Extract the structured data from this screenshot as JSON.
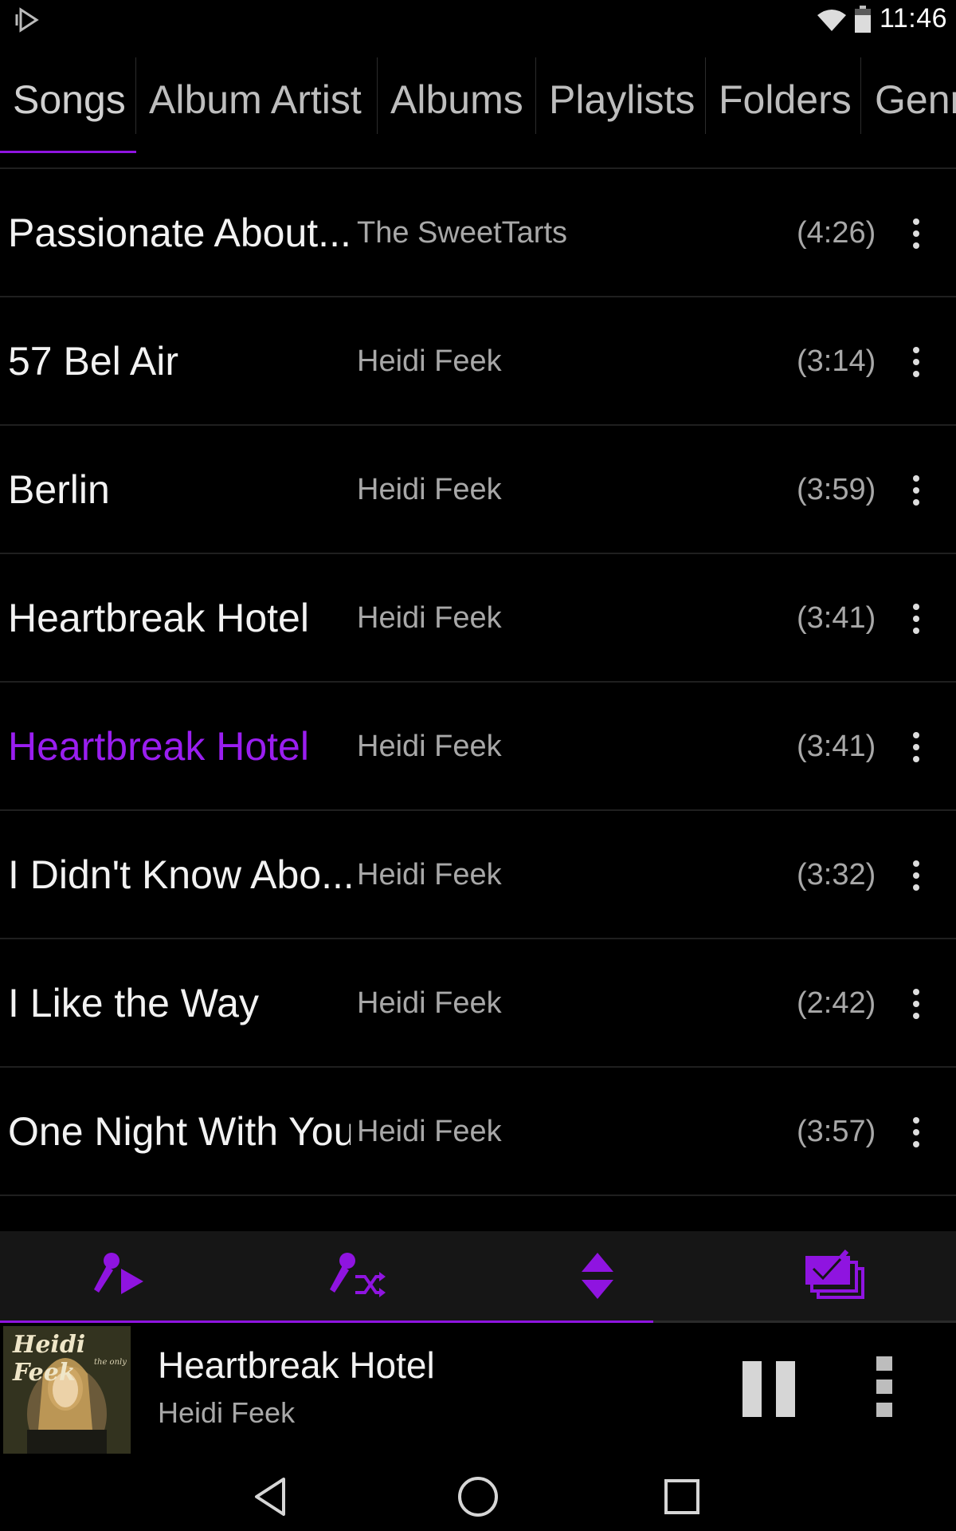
{
  "status_bar": {
    "time": "11:46",
    "icons": [
      "app-notification-icon",
      "wifi-icon",
      "battery-icon"
    ]
  },
  "tabs": [
    {
      "label": "Songs",
      "active": true
    },
    {
      "label": "Album Artist",
      "active": false
    },
    {
      "label": "Albums",
      "active": false
    },
    {
      "label": "Playlists",
      "active": false
    },
    {
      "label": "Folders",
      "active": false
    },
    {
      "label": "Genr",
      "active": false
    }
  ],
  "songs": [
    {
      "title": "Passionate About...",
      "artist": "The SweetTarts",
      "duration": "(4:26)"
    },
    {
      "title": "57 Bel Air",
      "artist": "Heidi Feek",
      "duration": "(3:14)"
    },
    {
      "title": "Berlin",
      "artist": "Heidi Feek",
      "duration": "(3:59)"
    },
    {
      "title": "Heartbreak Hotel",
      "artist": "Heidi Feek",
      "duration": "(3:41)"
    },
    {
      "title": "Heartbreak Hotel",
      "artist": "Heidi Feek",
      "duration": "(3:41)",
      "playing": true
    },
    {
      "title": "I Didn't Know Abo...",
      "artist": "Heidi Feek",
      "duration": "(3:32)"
    },
    {
      "title": "I Like the Way",
      "artist": "Heidi Feek",
      "duration": "(2:42)"
    },
    {
      "title": "One Night With You",
      "artist": "Heidi Feek",
      "duration": "(3:57)"
    }
  ],
  "action_bar": {
    "buttons": [
      "play-all-icon",
      "shuffle-all-icon",
      "sort-icon",
      "multi-select-icon"
    ]
  },
  "playback": {
    "progress": 0.683
  },
  "now_playing": {
    "title": "Heartbreak Hotel",
    "artist": "Heidi Feek",
    "album_art_text": "Heidi Feek",
    "album_art_subtext": "the only"
  },
  "colors": {
    "accent": "#8f14e0",
    "playing_text": "#9a1ef0",
    "background": "#000000",
    "action_bar": "#161616"
  },
  "nav_bar": {
    "buttons": [
      "back-icon",
      "home-icon",
      "recents-icon"
    ]
  }
}
